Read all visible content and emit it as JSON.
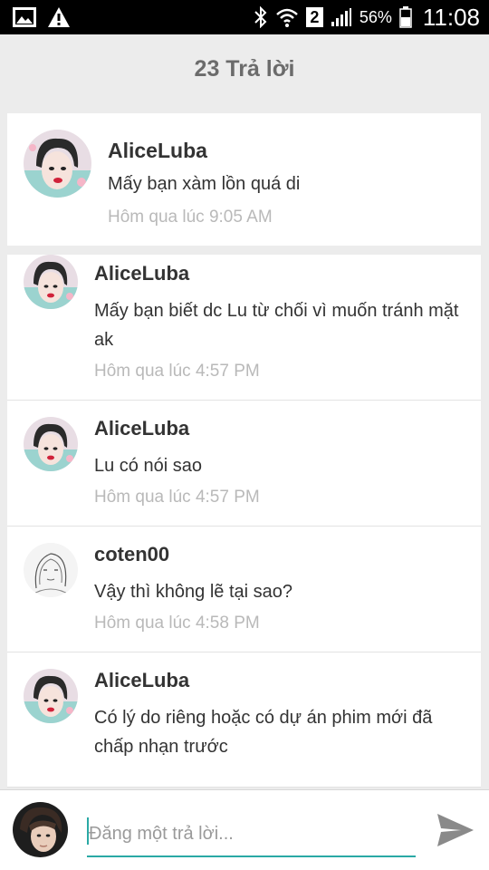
{
  "status_bar": {
    "sim_slot": "2",
    "battery": "56%",
    "time": "11:08",
    "icons": [
      "image-icon",
      "warning-icon",
      "bluetooth-icon",
      "wifi-icon",
      "signal-icon",
      "battery-icon"
    ]
  },
  "header": {
    "title": "23 Trả lời"
  },
  "original_post": {
    "author": "AliceLuba",
    "text": "Mấy bạn xàm lồn quá di",
    "time": "Hôm qua lúc 9:05 AM"
  },
  "replies": [
    {
      "author": "AliceLuba",
      "text": "Mấy bạn biết dc Lu từ chối vì muốn tránh mặt ak",
      "time": "Hôm qua lúc 4:57 PM"
    },
    {
      "author": "AliceLuba",
      "text": "Lu có nói sao",
      "time": "Hôm qua lúc 4:57 PM"
    },
    {
      "author": "coten00",
      "text": "Vậy thì không lẽ tại sao?",
      "time": "Hôm qua lúc 4:58 PM"
    },
    {
      "author": "AliceLuba",
      "text": "Có lý do riêng hoặc có dự án phim mới đã chấp nhạn trước",
      "time": ""
    }
  ],
  "compose": {
    "placeholder": "Đăng một trả lời...",
    "value": ""
  },
  "colors": {
    "accent": "#2aa9a5",
    "background": "#ececec",
    "timestamp": "#b9b9b9"
  }
}
